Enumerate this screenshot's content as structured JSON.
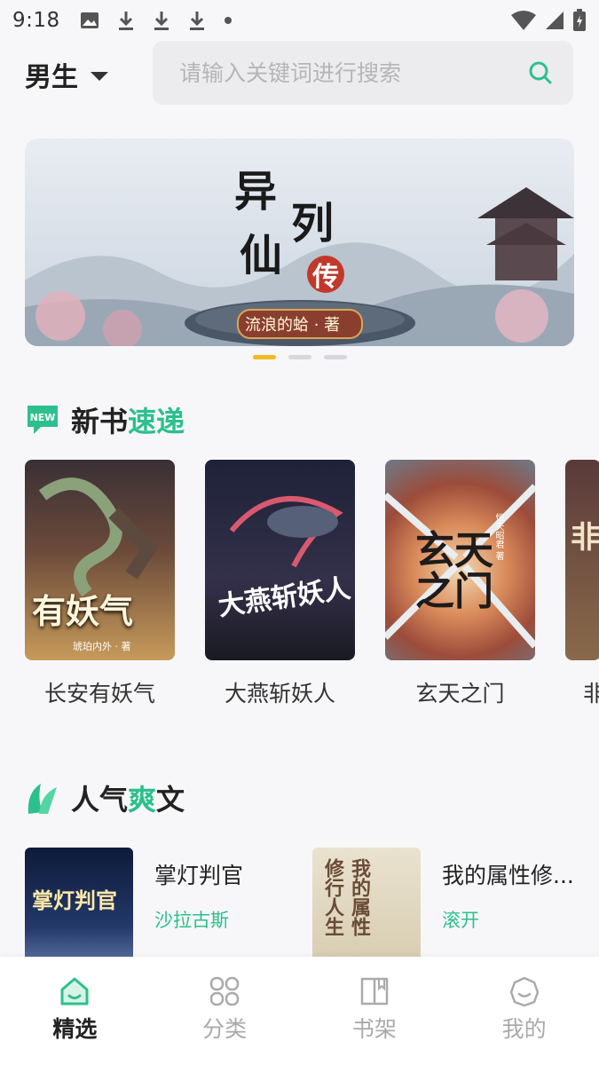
{
  "status_bar": {
    "time": "9:18"
  },
  "header": {
    "gender_label": "男生",
    "search_placeholder": "请输入关键词进行搜索"
  },
  "banner": {
    "title_chars": [
      "异",
      "列",
      "仙",
      "传"
    ],
    "author_tag": "流浪的蛤 · 著",
    "active_index": 0,
    "page_count": 3
  },
  "new_books": {
    "title_a": "新书",
    "title_b": "速递",
    "badge": "NEW",
    "items": [
      {
        "title": "长安有妖气",
        "cover_text": "有妖气",
        "cover_author": "琥珀内外 · 著"
      },
      {
        "title": "大燕斩妖人",
        "cover_text": "大燕斩妖人",
        "cover_author": ""
      },
      {
        "title": "玄天之门",
        "cover_text": "玄天之门",
        "cover_author": "恒天昭君 著"
      },
      {
        "title": "非",
        "cover_text": "非",
        "cover_author": ""
      }
    ]
  },
  "popular": {
    "title_a": "人气",
    "title_b": "爽",
    "title_c": "文",
    "items": [
      {
        "title": "掌灯判官",
        "author": "沙拉古斯",
        "cover_text": "掌灯判官"
      },
      {
        "title": "我的属性修...",
        "author": "滚开",
        "cover_text": "我的属性 修行人生"
      }
    ]
  },
  "bottom_nav": [
    {
      "label": "精选",
      "icon": "home-icon",
      "active": true
    },
    {
      "label": "分类",
      "icon": "category-icon",
      "active": false
    },
    {
      "label": "书架",
      "icon": "bookshelf-icon",
      "active": false
    },
    {
      "label": "我的",
      "icon": "profile-icon",
      "active": false
    }
  ],
  "colors": {
    "accent": "#2cc08c",
    "indicator": "#f2b924"
  }
}
